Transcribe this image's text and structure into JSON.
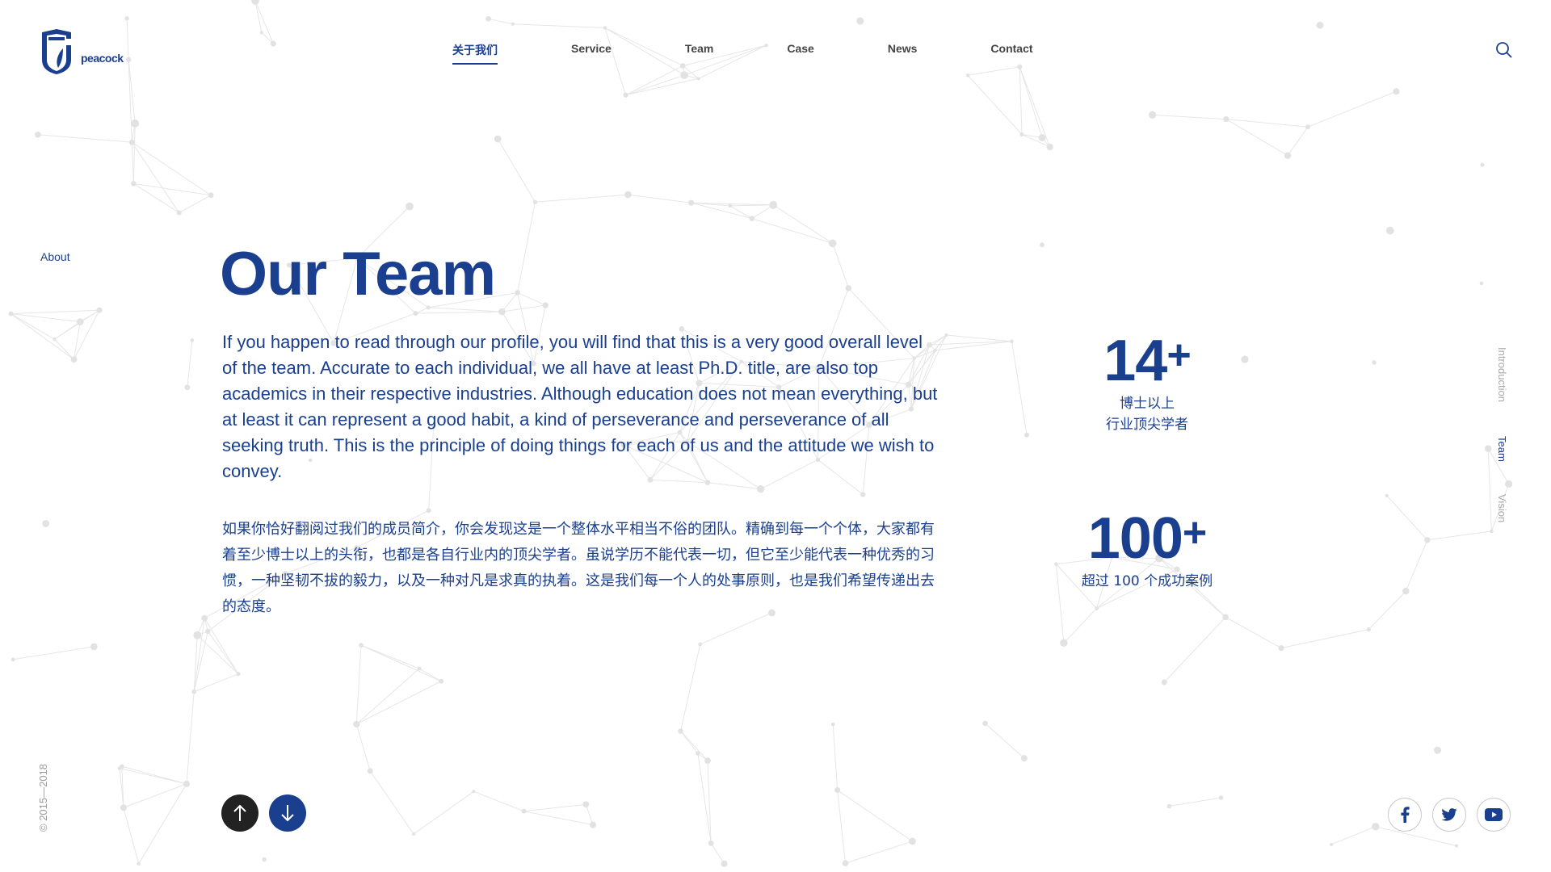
{
  "brand": {
    "name": "peacock",
    "color": "#1a3f8f"
  },
  "nav": {
    "items": [
      {
        "label": "关于我们",
        "active": true
      },
      {
        "label": "Service",
        "active": false
      },
      {
        "label": "Team",
        "active": false
      },
      {
        "label": "Case",
        "active": false
      },
      {
        "label": "News",
        "active": false
      },
      {
        "label": "Contact",
        "active": false
      }
    ],
    "search_icon": "search-icon"
  },
  "side": {
    "section_label": "About"
  },
  "copyright": "© 2015—2018",
  "main": {
    "title": "Our Team",
    "paragraph_en": "If you happen to read through our profile, you will find that this is a very good overall level of the team. Accurate to each individual, we all have at least Ph.D. title, are also top academics in their respective industries. Although education does not mean everything, but at least it can represent a good habit, a kind of perseverance and perseverance of all seeking truth. This is the principle of doing things for each of us and the attitude we wish to convey.",
    "paragraph_cn": "如果你恰好翻阅过我们的成员简介，你会发现这是一个整体水平相当不俗的团队。精确到每一个个体，大家都有着至少博士以上的头衔，也都是各自行业内的顶尖学者。虽说学历不能代表一切，但它至少能代表一种优秀的习惯，一种坚韧不拔的毅力，以及一种对凡是求真的执着。这是我们每一个人的处事原则，也是我们希望传递出去的态度。"
  },
  "stats": [
    {
      "number": "14",
      "suffix": "+",
      "label_line1": "博士以上",
      "label_line2": "行业顶尖学者"
    },
    {
      "number": "100",
      "suffix": "+",
      "label_line1": "超过 100 个成功案例",
      "label_line2": ""
    }
  ],
  "vertical_nav": [
    {
      "label": "Introduction",
      "active": false
    },
    {
      "label": "Team",
      "active": true
    },
    {
      "label": "Vision",
      "active": false
    }
  ],
  "controls": {
    "up_icon": "arrow-up-icon",
    "down_icon": "arrow-down-icon"
  },
  "social": [
    {
      "icon": "facebook-icon"
    },
    {
      "icon": "twitter-icon"
    },
    {
      "icon": "youtube-icon"
    }
  ],
  "colors": {
    "accent": "#1a3f8f",
    "dark_button": "#222222",
    "muted": "#aaaaaa"
  }
}
